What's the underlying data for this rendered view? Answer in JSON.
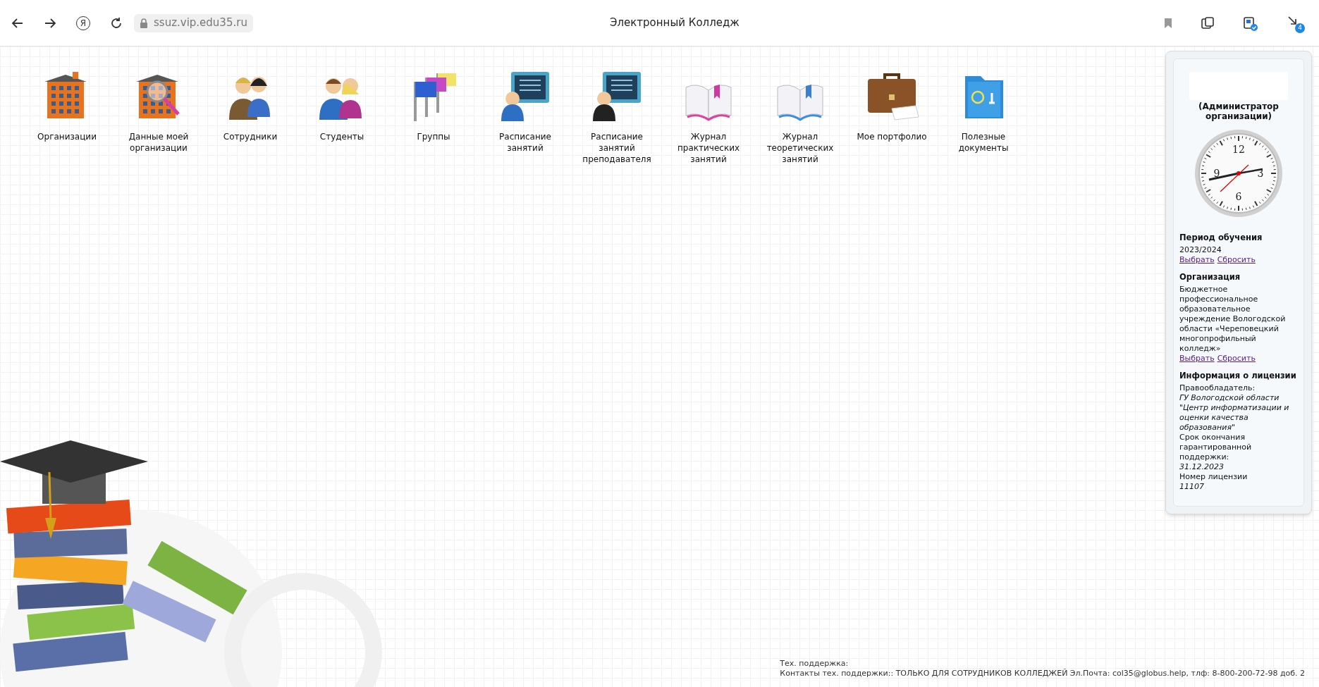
{
  "browser": {
    "logo": "Я",
    "url": "ssuz.vip.edu35.ru",
    "title": "Электронный Колледж",
    "downloads_badge": "4"
  },
  "apps": [
    {
      "kind": "building",
      "label": "Организации"
    },
    {
      "kind": "building-search",
      "label": "Данные моей организации"
    },
    {
      "kind": "staff",
      "label": "Сотрудники"
    },
    {
      "kind": "students",
      "label": "Студенты"
    },
    {
      "kind": "flags",
      "label": "Группы"
    },
    {
      "kind": "monitor-casual",
      "label": "Расписание занятий"
    },
    {
      "kind": "monitor-suit",
      "label": "Расписание занятий преподавателя"
    },
    {
      "kind": "book-pink",
      "label": "Журнал практических занятий"
    },
    {
      "kind": "book-blue",
      "label": "Журнал теоретических занятий"
    },
    {
      "kind": "briefcase",
      "label": "Мое портфолио"
    },
    {
      "kind": "folder",
      "label": "Полезные документы"
    }
  ],
  "sidebar": {
    "role": "(Администратор организации)",
    "clock": {
      "numerals": [
        "12",
        "3",
        "6",
        "9"
      ]
    },
    "sections": [
      {
        "title": "Период обучения",
        "lines": [
          {
            "text": "2023/2024",
            "italic": false
          }
        ],
        "links": [
          "Выбрать",
          "Сбросить"
        ]
      },
      {
        "title": "Организация",
        "lines": [
          {
            "text": "Бюджетное профессиональное образовательное учреждение Вологодской области «Череповецкий многопрофильный колледж»",
            "italic": false
          }
        ],
        "links": [
          "Выбрать",
          "Сбросить"
        ]
      },
      {
        "title": "Информация о лицензии",
        "lines": [
          {
            "text": "Правообладатель:",
            "italic": false
          },
          {
            "text": "ГУ Вологодской области \"Центр информатизации и оценки качества образования\"",
            "italic": true
          },
          {
            "text": "Срок окончания гарантированной поддержки:",
            "italic": false
          },
          {
            "text": "31.12.2023",
            "italic": true
          },
          {
            "text": "Номер лицензии",
            "italic": false
          },
          {
            "text": "11107",
            "italic": true
          }
        ]
      }
    ]
  },
  "footer": {
    "lines": [
      "Тех. поддержка:",
      "Контакты тех. поддержки:: ТОЛЬКО ДЛЯ СОТРУДНИКОВ КОЛЛЕДЖЕЙ Эл.Почта: col35@globus.help, тлф: 8-800-200-72-98 доб. 2"
    ]
  }
}
